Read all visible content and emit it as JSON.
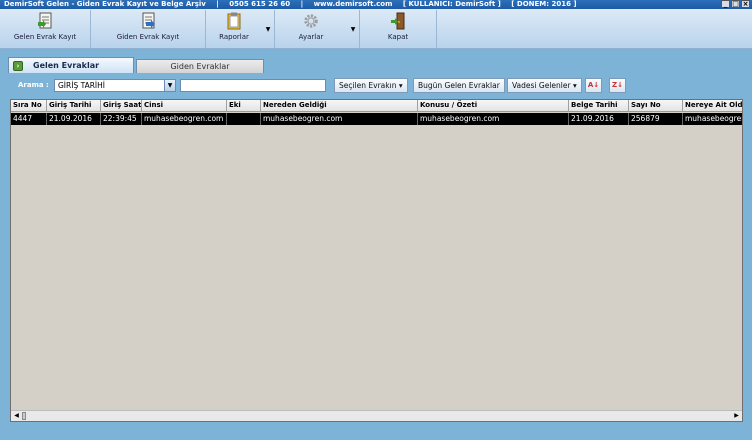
{
  "window": {
    "title_parts": [
      "DemirSoft Gelen - Giden Evrak Kayıt ve Belge Arşiv",
      "|",
      "0505 615 26 60",
      "|",
      "www.demirsoft.com",
      "[ KULLANICI: DemirSoft ]",
      "[ DÖNEM: 2016 ]"
    ],
    "controls": [
      "_",
      "□",
      "×"
    ]
  },
  "toolbar": {
    "gelen": "Gelen Evrak Kayıt",
    "giden": "Giden Evrak Kayıt",
    "raporlar": "Raporlar",
    "ayarlar": "Ayarlar",
    "kapat": "Kapat",
    "dropdown_arrow": "▼"
  },
  "tabs": {
    "gelen": "Gelen Evraklar",
    "giden": "Giden Evraklar"
  },
  "search": {
    "label": "Arama :",
    "combo_value": "GİRİŞ TARİHİ",
    "text_value": "",
    "secilen": "Seçilen Evrakın",
    "bugun": "Bugün Gelen Evraklar",
    "vadesi": "Vadesi Gelenler",
    "sort_az": "A↓",
    "sort_za": "Z↓"
  },
  "grid": {
    "columns": [
      "Sıra No",
      "Giriş Tarihi",
      "Giriş Saati",
      "Cinsi",
      "Eki",
      "Nereden Geldiği",
      "Konusu / Özeti",
      "Belge Tarihi",
      "Sayı No",
      "Nereye Ait Oldu"
    ],
    "rows": [
      [
        "4447",
        "21.09.2016",
        "22:39:45",
        "muhasebeogren.com",
        "",
        "muhasebeogren.com",
        "muhasebeogren.com",
        "21.09.2016",
        "256879",
        "muhasebeogren"
      ]
    ]
  },
  "colors": {
    "background": "#7eb3d8",
    "grid_bg": "#d4d0c8",
    "selected_row": "#000000",
    "titlebar": "#2d6fb8"
  }
}
